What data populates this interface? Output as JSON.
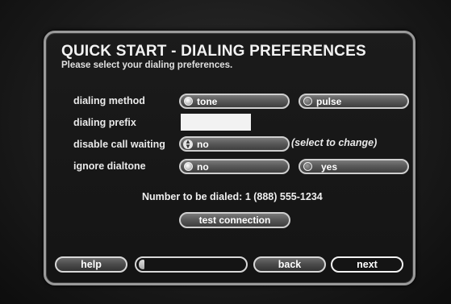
{
  "header": {
    "title": "QUICK START - DIALING PREFERENCES",
    "subtitle": "Please select your dialing preferences."
  },
  "form": {
    "dialing_method": {
      "label": "dialing method",
      "options": [
        "tone",
        "pulse"
      ],
      "selected": "tone"
    },
    "dialing_prefix": {
      "label": "dialing prefix",
      "value": ""
    },
    "disable_call_waiting": {
      "label": "disable call waiting",
      "value": "no",
      "hint": "(select to change)"
    },
    "ignore_dialtone": {
      "label": "ignore dialtone",
      "options": [
        "no",
        "yes"
      ],
      "selected": "no"
    }
  },
  "number": {
    "label": "Number to be dialed:",
    "value": "1 (888) 555-1234"
  },
  "test_button": "test connection",
  "nav": {
    "help": "help",
    "back": "back",
    "next": "next",
    "progress": 0.05
  }
}
